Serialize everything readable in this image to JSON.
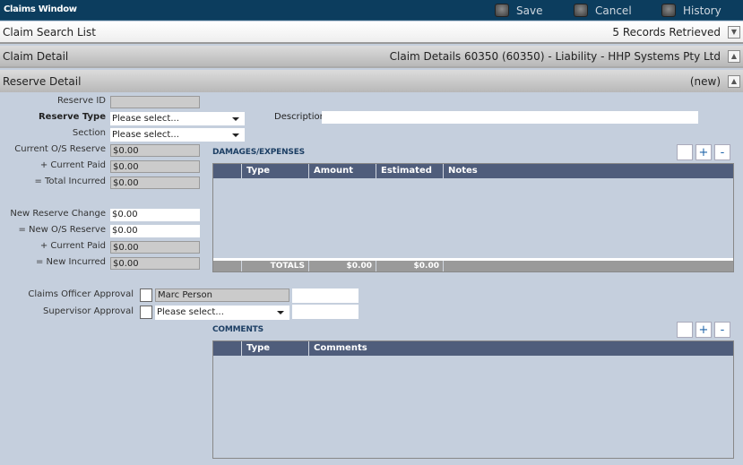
{
  "window": {
    "title": "Claims Window",
    "buttons": [
      {
        "label": "Save",
        "icon": "save-icon"
      },
      {
        "label": "Cancel",
        "icon": "cancel-icon"
      },
      {
        "label": "History",
        "icon": "history-icon"
      }
    ]
  },
  "search_list": {
    "title": "Claim Search List",
    "status": "5 Records Retrieved"
  },
  "claim_detail": {
    "title": "Claim Detail",
    "summary": "Claim Details 60350 (60350) - Liability - HHP Systems Pty Ltd"
  },
  "reserve_detail": {
    "title": "Reserve Detail",
    "status": "(new)"
  },
  "form": {
    "reserve_id": {
      "label": "Reserve ID",
      "value": ""
    },
    "reserve_type": {
      "label": "Reserve Type",
      "value": "Please select..."
    },
    "section": {
      "label": "Section",
      "value": "Please select..."
    },
    "description": {
      "label": "Description",
      "value": ""
    },
    "current_os": {
      "label": "Current O/S Reserve",
      "value": "$0.00"
    },
    "current_paid": {
      "label": "+ Current Paid",
      "value": "$0.00"
    },
    "total_incurred": {
      "label": "= Total Incurred",
      "value": "$0.00"
    },
    "new_change": {
      "label": "New Reserve Change",
      "value": "$0.00"
    },
    "new_os": {
      "label": "= New O/S Reserve",
      "value": "$0.00"
    },
    "current_paid2": {
      "label": "+ Current Paid",
      "value": "$0.00"
    },
    "new_incurred": {
      "label": "= New Incurred",
      "value": "$0.00"
    },
    "officer_approval": {
      "label": "Claims Officer Approval",
      "value": "Marc Person",
      "extra": ""
    },
    "supervisor_approval": {
      "label": "Supervisor Approval",
      "value": "Please select...",
      "extra": ""
    }
  },
  "damages": {
    "title": "DAMAGES/EXPENSES",
    "add": "+",
    "remove": "-",
    "columns": [
      "",
      "Type",
      "Amount",
      "Estimated",
      "Notes"
    ],
    "totals": {
      "label": "TOTALS",
      "amount": "$0.00",
      "estimated": "$0.00"
    }
  },
  "comments": {
    "title": "COMMENTS",
    "add": "+",
    "remove": "-",
    "columns": [
      "",
      "Type",
      "Comments"
    ]
  }
}
